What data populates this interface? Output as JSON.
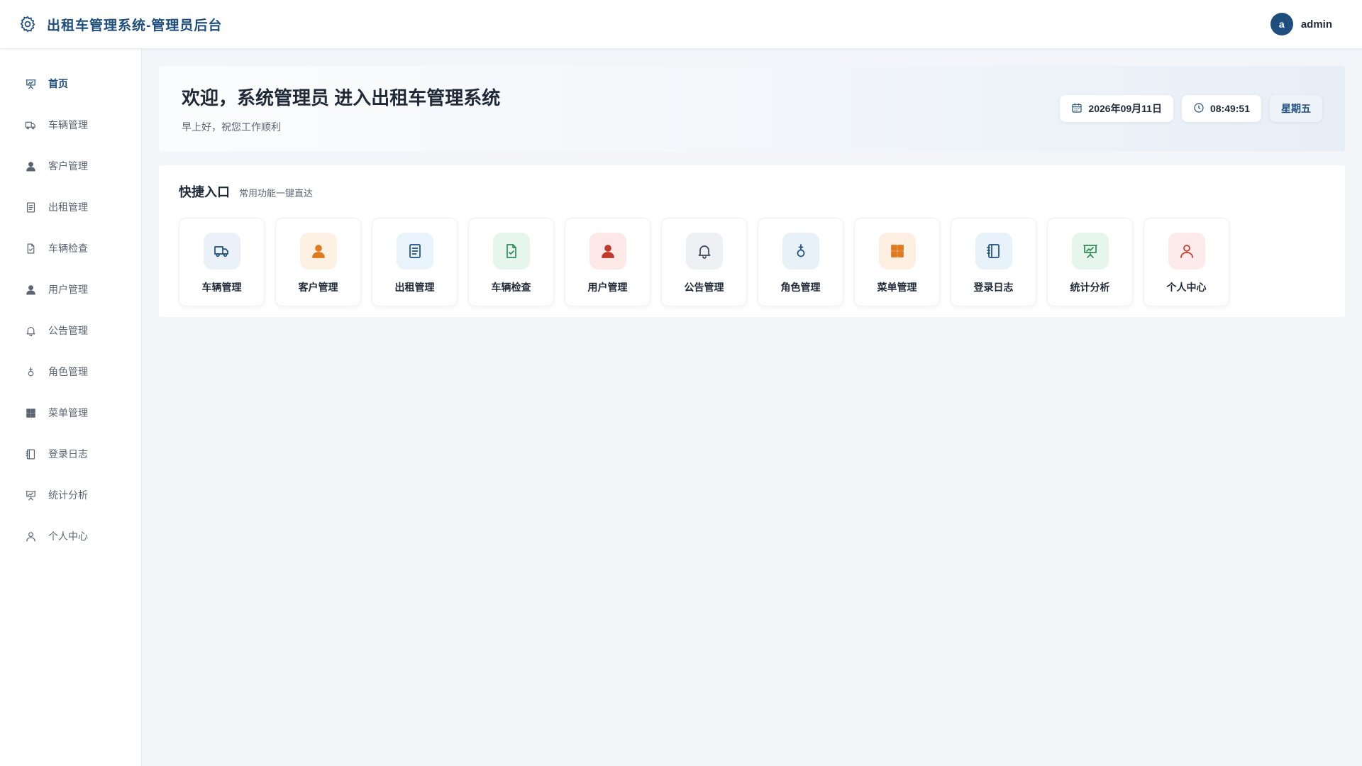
{
  "header": {
    "title": "出租车管理系统-管理员后台",
    "brand_icon": "gear-icon",
    "user": {
      "avatar_letter": "a",
      "name": "admin"
    }
  },
  "sidebar": {
    "items": [
      {
        "label": "首页",
        "icon": "presentation-chart-icon",
        "active": true
      },
      {
        "label": "车辆管理",
        "icon": "truck-icon"
      },
      {
        "label": "客户管理",
        "icon": "user-icon"
      },
      {
        "label": "出租管理",
        "icon": "document-icon"
      },
      {
        "label": "车辆检查",
        "icon": "document-check-icon"
      },
      {
        "label": "用户管理",
        "icon": "user-icon"
      },
      {
        "label": "公告管理",
        "icon": "bell-icon"
      },
      {
        "label": "角色管理",
        "icon": "female-icon"
      },
      {
        "label": "菜单管理",
        "icon": "grid-icon"
      },
      {
        "label": "登录日志",
        "icon": "notebook-icon"
      },
      {
        "label": "统计分析",
        "icon": "presentation-chart-icon"
      },
      {
        "label": "个人中心",
        "icon": "user-outline-icon"
      }
    ]
  },
  "welcome": {
    "title": "欢迎，系统管理员 进入出租车管理系统",
    "subtitle": "早上好，祝您工作顺利",
    "date": "2026年09月11日",
    "time": "08:49:51",
    "weekday": "星期五"
  },
  "quick": {
    "title": "快捷入口",
    "subtitle": "常用功能一键直达",
    "cards": [
      {
        "label": "车辆管理",
        "icon": "truck-icon",
        "bg": "#eaf1f8",
        "fg": "#1d4e7e"
      },
      {
        "label": "客户管理",
        "icon": "user-icon",
        "bg": "#fdf1e4",
        "fg": "#e07a1f"
      },
      {
        "label": "出租管理",
        "icon": "document-icon",
        "bg": "#e8f3fc",
        "fg": "#1d4e7e"
      },
      {
        "label": "车辆检查",
        "icon": "document-check-icon",
        "bg": "#e6f6ec",
        "fg": "#2e8b57"
      },
      {
        "label": "用户管理",
        "icon": "user-icon",
        "bg": "#fde8e8",
        "fg": "#c0392b"
      },
      {
        "label": "公告管理",
        "icon": "bell-icon",
        "bg": "#eef0f4",
        "fg": "#3a4556"
      },
      {
        "label": "角色管理",
        "icon": "female-icon",
        "bg": "#e8f0f8",
        "fg": "#1d4e7e"
      },
      {
        "label": "菜单管理",
        "icon": "grid-icon",
        "bg": "#fdf0e2",
        "fg": "#e07a1f"
      },
      {
        "label": "登录日志",
        "icon": "notebook-icon",
        "bg": "#e8f2fb",
        "fg": "#1d4e7e"
      },
      {
        "label": "统计分析",
        "icon": "presentation-chart-icon",
        "bg": "#e6f6ec",
        "fg": "#2e8b57"
      },
      {
        "label": "个人中心",
        "icon": "user-outline-icon",
        "bg": "#fdeaea",
        "fg": "#c0392b"
      }
    ]
  }
}
